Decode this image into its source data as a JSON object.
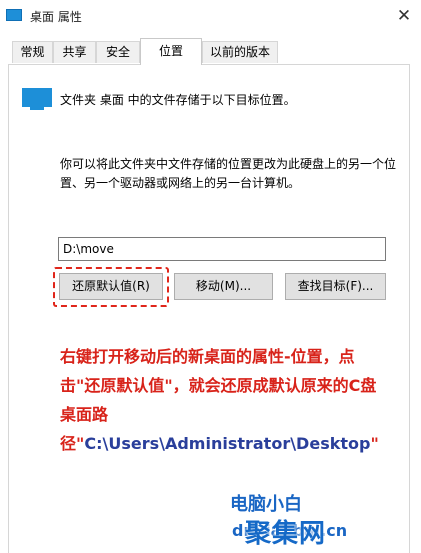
{
  "window": {
    "title": "桌面 属性",
    "close_glyph": "✕"
  },
  "tabs": [
    "常规",
    "共享",
    "安全",
    "位置",
    "以前的版本"
  ],
  "active_tab": "位置",
  "location": {
    "header": "文件夹 桌面 中的文件存储于以下目标位置。",
    "description": "你可以将此文件夹中文件存储的位置更改为此硬盘上的另一个位置、另一个驱动器或网络上的另一台计算机。",
    "path_value": "D:\\move",
    "buttons": {
      "restore_default": "还原默认值(R)",
      "move": "移动(M)...",
      "find_target": "查找目标(F)..."
    }
  },
  "annotation": {
    "text": "右键打开移动后的新桌面的属性-位置，点击\"还原默认值\"，就会还原成默认原来的C盘桌面路径\"",
    "path": "C:\\Users\\Administrator\\Desktop",
    "closing_quote": "\""
  },
  "watermark": {
    "line1": "电脑小白",
    "line2": "dnxiaobai.cn",
    "logo": "聚集网"
  },
  "colors": {
    "annotation_red": "#d8231a",
    "annotation_blue": "#2a3f9b",
    "watermark_blue": "#1a66c4",
    "folder_blue": "#1d8fd8"
  }
}
